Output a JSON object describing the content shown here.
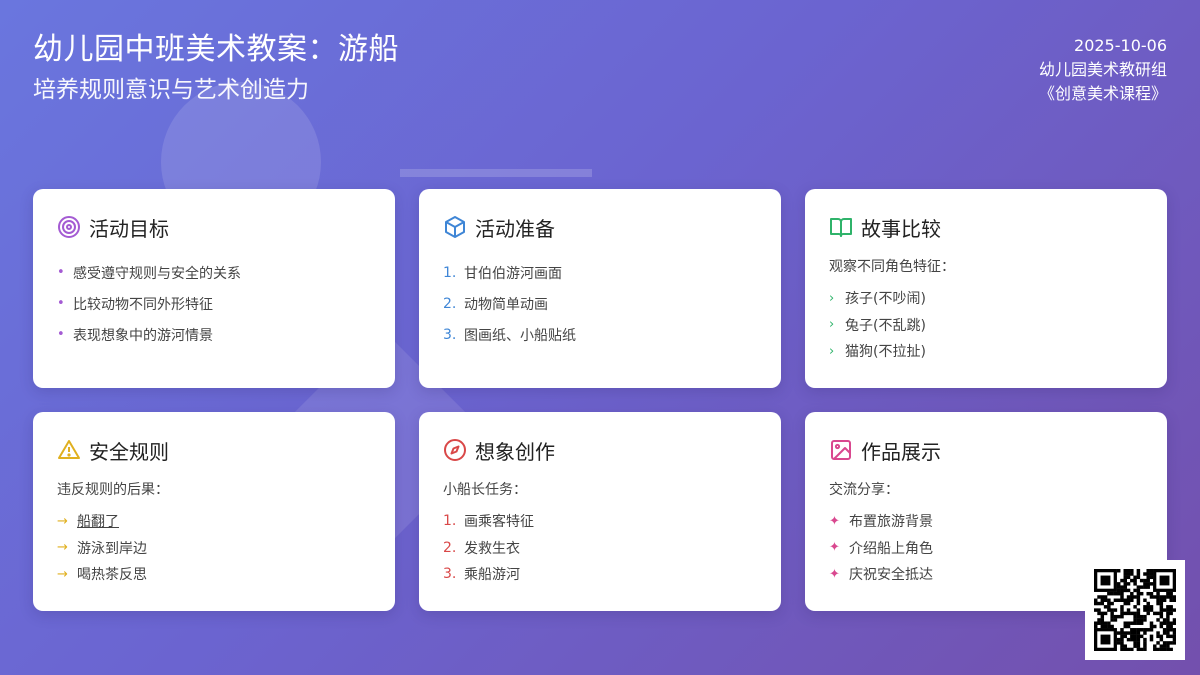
{
  "header": {
    "title": "幼儿园中班美术教案：游船",
    "subtitle": "培养规则意识与艺术创造力",
    "date": "2025-10-06",
    "author": "幼儿园美术教研组",
    "course": "《创意美术课程》"
  },
  "cards": {
    "goals": {
      "title": "活动目标",
      "color": "#a45bd3",
      "items": [
        "感受遵守规则与安全的关系",
        "比较动物不同外形特征",
        "表现想象中的游河情景"
      ]
    },
    "prep": {
      "title": "活动准备",
      "color": "#3f86d6",
      "items": [
        "甘伯伯游河画面",
        "动物简单动画",
        "图画纸、小船贴纸"
      ],
      "numbers": [
        "1.",
        "2.",
        "3."
      ]
    },
    "story": {
      "title": "故事比较",
      "color": "#2fb36a",
      "intro": "观察不同角色特征：",
      "items": [
        "孩子(不吵闹)",
        "兔子(不乱跳)",
        "猫狗(不拉扯)"
      ]
    },
    "safety": {
      "title": "安全规则",
      "color": "#e0b020",
      "intro": "违反规则的后果：",
      "items": [
        "船翻了",
        "游泳到岸边",
        "喝热茶反思"
      ]
    },
    "create": {
      "title": "想象创作",
      "color": "#d94848",
      "intro": "小船长任务：",
      "items": [
        "画乘客特征",
        "发救生衣",
        "乘船游河"
      ],
      "numbers": [
        "1.",
        "2.",
        "3."
      ]
    },
    "show": {
      "title": "作品展示",
      "color": "#d9488f",
      "intro": "交流分享：",
      "items": [
        "布置旅游背景",
        "介绍船上角色",
        "庆祝安全抵达"
      ]
    }
  },
  "icons": {
    "goals": "target-icon",
    "prep": "cube-icon",
    "story": "open-book-icon",
    "safety": "warning-icon",
    "create": "compass-icon",
    "show": "image-icon"
  }
}
